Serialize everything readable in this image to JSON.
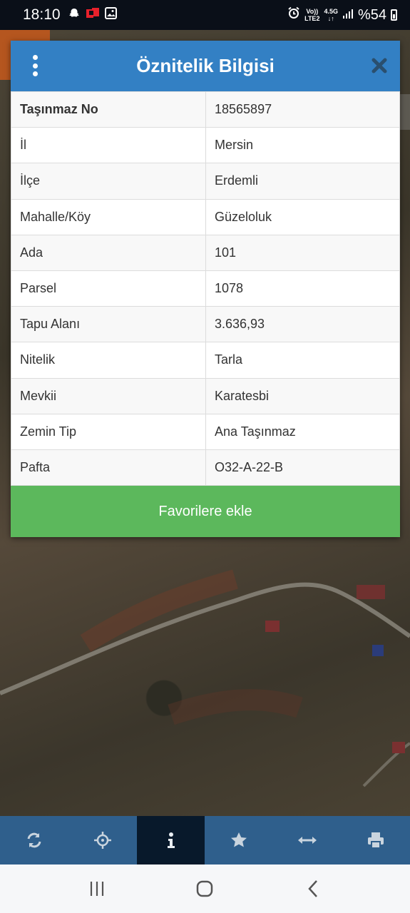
{
  "status_bar": {
    "time": "18:10",
    "net_top": "Vo))",
    "net_bottom": "LTE2",
    "net_gen": "4.5G",
    "battery": "%54"
  },
  "dialog": {
    "title": "Öznitelik Bilgisi",
    "rows": [
      {
        "key": "Taşınmaz No",
        "value": "18565897"
      },
      {
        "key": "İl",
        "value": "Mersin"
      },
      {
        "key": "İlçe",
        "value": "Erdemli"
      },
      {
        "key": "Mahalle/Köy",
        "value": "Güzeloluk"
      },
      {
        "key": "Ada",
        "value": "101"
      },
      {
        "key": "Parsel",
        "value": "1078"
      },
      {
        "key": "Tapu Alanı",
        "value": "3.636,93"
      },
      {
        "key": "Nitelik",
        "value": "Tarla"
      },
      {
        "key": "Mevkii",
        "value": "Karatesbi"
      },
      {
        "key": "Zemin Tip",
        "value": "Ana Taşınmaz"
      },
      {
        "key": "Pafta",
        "value": "O32-A-22-B"
      }
    ],
    "favorite_button": "Favorilere ekle"
  },
  "toolbar": {
    "tools": [
      "refresh-icon",
      "locate-icon",
      "info-icon",
      "star-icon",
      "measure-icon",
      "print-icon"
    ],
    "active_tool": "info-icon"
  },
  "colors": {
    "header": "#3380c4",
    "toolbar": "#2f5f8c",
    "toolbar_active": "#08192b",
    "favorite": "#5cb85c"
  }
}
